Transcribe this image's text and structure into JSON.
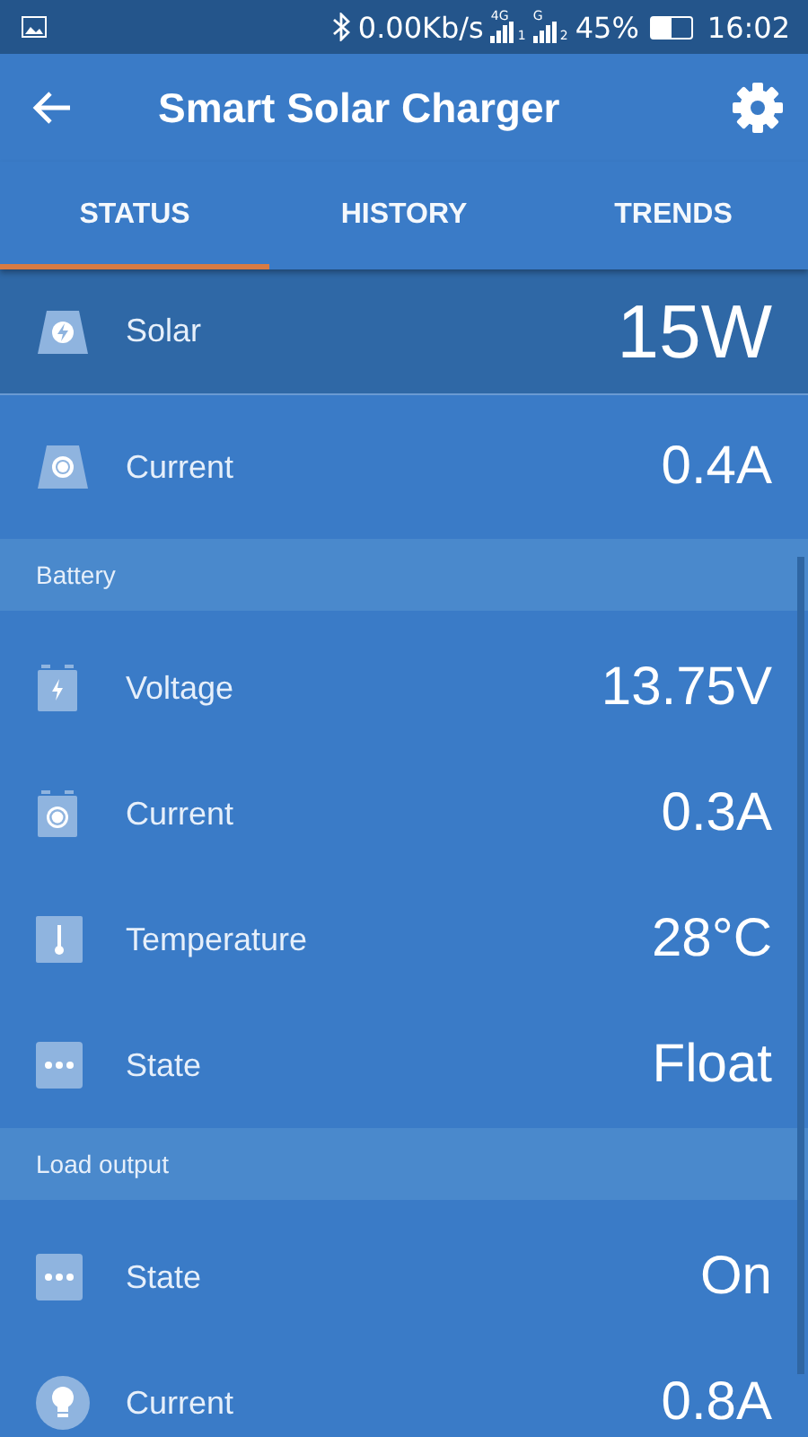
{
  "status_bar": {
    "speed": "0.00Kb/s",
    "signals": [
      {
        "network": "4G",
        "sim": "1"
      },
      {
        "network": "G",
        "sim": "2"
      }
    ],
    "battery": {
      "percent": "45%",
      "level": 0.5
    },
    "time": "16:02"
  },
  "app_bar": {
    "title": "Smart Solar Charger"
  },
  "tabs": [
    {
      "label": "STATUS",
      "selected": true
    },
    {
      "label": "HISTORY",
      "selected": false
    },
    {
      "label": "TRENDS",
      "selected": false
    }
  ],
  "sections": [
    {
      "rows": [
        {
          "kind": "solar-power",
          "label": "Solar",
          "value": "15W",
          "selected": true
        },
        {
          "kind": "solar-current",
          "label": "Current",
          "value": "0.4A",
          "selected": false
        }
      ]
    },
    {
      "title": "Battery",
      "rows": [
        {
          "kind": "battery-voltage",
          "label": "Voltage",
          "value": "13.75V",
          "selected": false
        },
        {
          "kind": "battery-current",
          "label": "Current",
          "value": "0.3A",
          "selected": false
        },
        {
          "kind": "temperature",
          "label": "Temperature",
          "value": "28°C",
          "selected": false
        },
        {
          "kind": "state",
          "label": "State",
          "value": "Float",
          "selected": false
        }
      ]
    },
    {
      "title": "Load output",
      "rows": [
        {
          "kind": "state",
          "label": "State",
          "value": "On",
          "selected": false
        },
        {
          "kind": "load-current",
          "label": "Current",
          "value": "0.8A",
          "selected": false
        }
      ]
    }
  ]
}
